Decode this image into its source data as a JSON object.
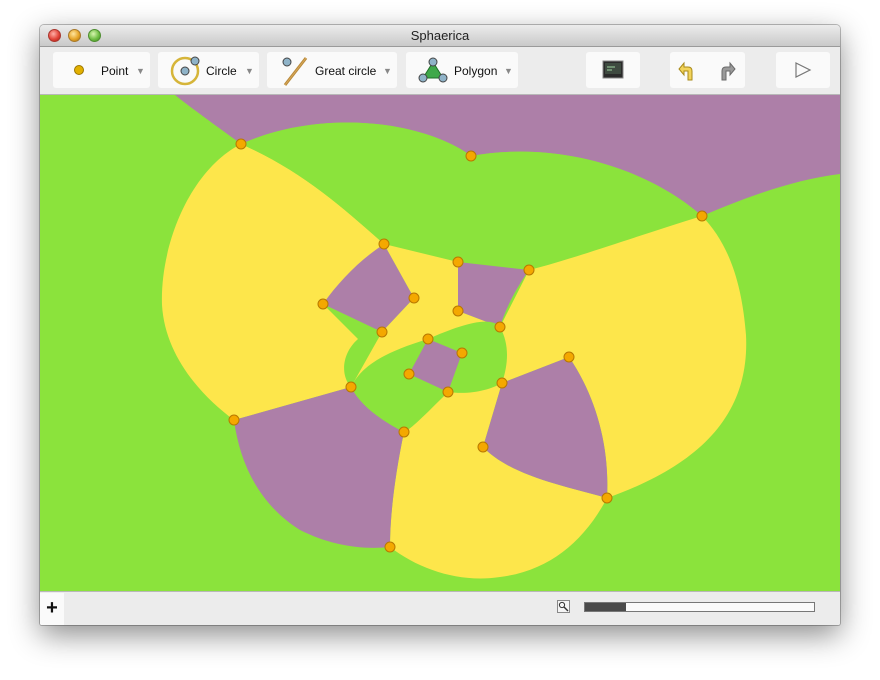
{
  "window": {
    "title": "Sphaerica"
  },
  "toolbar": {
    "point_label": "Point",
    "circle_label": "Circle",
    "great_circle_label": "Great circle",
    "polygon_label": "Polygon",
    "dropdown_glyph": "▼"
  },
  "bottombar": {
    "add_label": "+",
    "progress_fraction": 0.18
  },
  "colors": {
    "green": "#8be33c",
    "yellow": "#fde64b",
    "purple": "#ad7fa8",
    "point_fill": "#f4a800",
    "point_stroke": "#b87800"
  }
}
